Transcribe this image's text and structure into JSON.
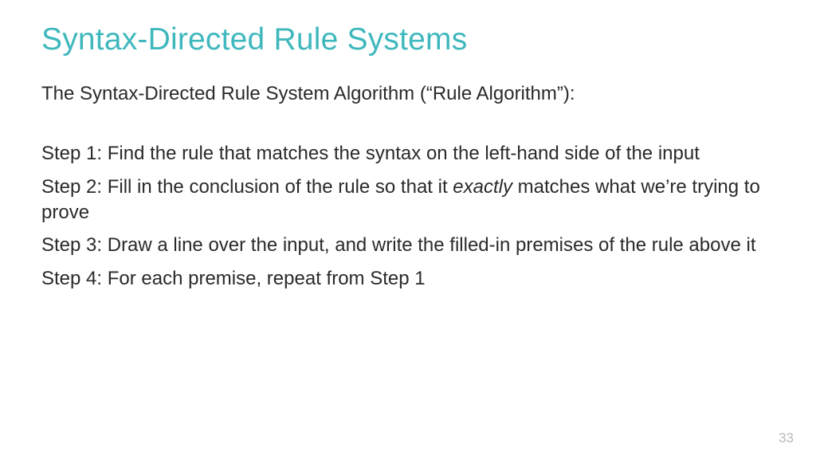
{
  "slide": {
    "title": "Syntax-Directed Rule Systems",
    "intro": "The Syntax-Directed Rule System Algorithm (“Rule Algorithm”):",
    "steps": [
      {
        "label": "Step 1:",
        "text": "Find the rule that matches the syntax on the left-hand side of the input"
      },
      {
        "label": "Step 2:",
        "text_before": "Fill in the conclusion of the rule so that it ",
        "emphasis": "exactly",
        "text_after": " matches what we’re trying to prove"
      },
      {
        "label": "Step 3:",
        "text": "Draw a line over the input, and write the filled-in premises of the rule above it"
      },
      {
        "label": "Step 4:",
        "text": "For each premise, repeat from Step 1"
      }
    ],
    "page_number": "33"
  }
}
